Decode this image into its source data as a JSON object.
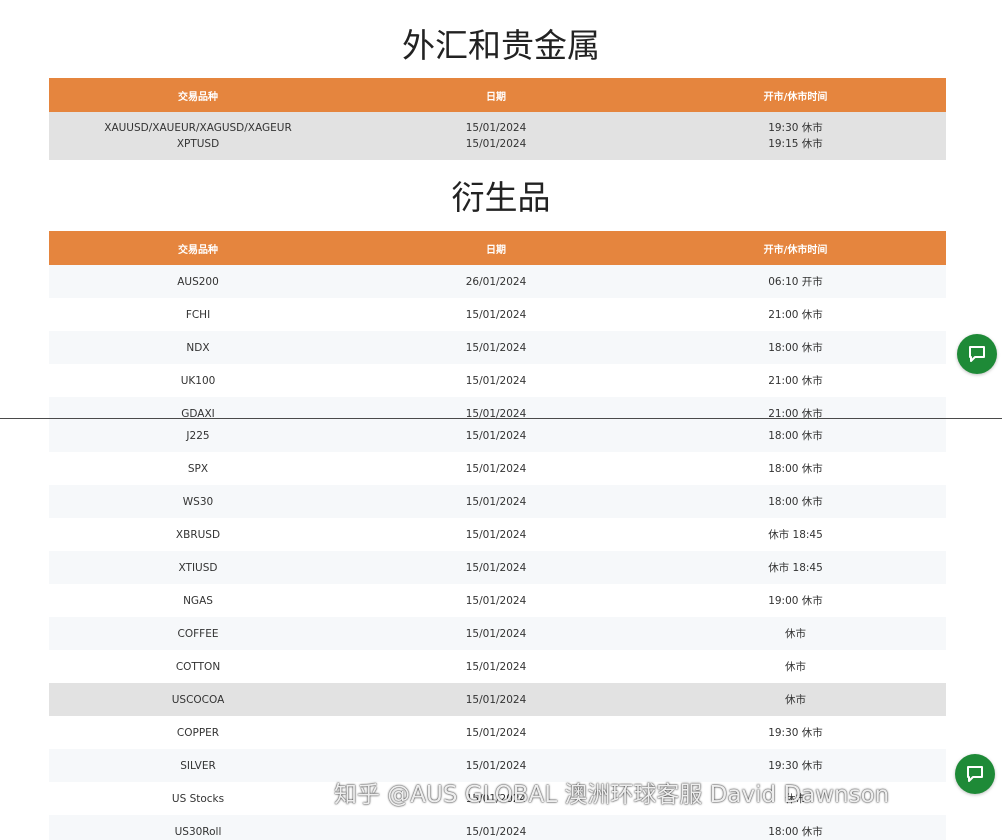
{
  "forex_section": {
    "title": "外汇和贵金属",
    "headers": [
      "交易品种",
      "日期",
      "开市/休市时间"
    ],
    "rows": [
      {
        "symbol": [
          "XAUUSD/XAUEUR/XAGUSD/XAGEUR",
          "XPTUSD"
        ],
        "date": [
          "15/01/2024",
          "15/01/2024"
        ],
        "time": [
          "19:30 休市",
          "19:15 休市"
        ]
      }
    ]
  },
  "derivatives_section": {
    "title": "衍生品",
    "headers": [
      "交易品种",
      "日期",
      "开市/休市时间"
    ],
    "rows_top": [
      {
        "symbol": "AUS200",
        "date": "26/01/2024",
        "time": "06:10 开市"
      },
      {
        "symbol": "FCHI",
        "date": "15/01/2024",
        "time": "21:00 休市"
      },
      {
        "symbol": "NDX",
        "date": "15/01/2024",
        "time": "18:00 休市"
      },
      {
        "symbol": "UK100",
        "date": "15/01/2024",
        "time": "21:00 休市"
      },
      {
        "symbol": "GDAXI",
        "date": "15/01/2024",
        "time": "21:00 休市"
      }
    ],
    "rows_bottom": [
      {
        "symbol": "J225",
        "date": "15/01/2024",
        "time": "18:00 休市"
      },
      {
        "symbol": "SPX",
        "date": "15/01/2024",
        "time": "18:00 休市"
      },
      {
        "symbol": "WS30",
        "date": "15/01/2024",
        "time": "18:00 休市"
      },
      {
        "symbol": "XBRUSD",
        "date": "15/01/2024",
        "time": "休市 18:45"
      },
      {
        "symbol": "XTIUSD",
        "date": "15/01/2024",
        "time": "休市 18:45"
      },
      {
        "symbol": "NGAS",
        "date": "15/01/2024",
        "time": "19:00 休市"
      },
      {
        "symbol": "COFFEE",
        "date": "15/01/2024",
        "time": "休市"
      },
      {
        "symbol": "COTTON",
        "date": "15/01/2024",
        "time": "休市"
      },
      {
        "symbol": "USCOCOA",
        "date": "15/01/2024",
        "time": "休市"
      },
      {
        "symbol": "COPPER",
        "date": "15/01/2024",
        "time": "19:30 休市"
      },
      {
        "symbol": "SILVER",
        "date": "15/01/2024",
        "time": "19:30 休市"
      },
      {
        "symbol": "US Stocks",
        "date": "15/01/2024",
        "time": "休市"
      },
      {
        "symbol": "US30Roll",
        "date": "15/01/2024",
        "time": "18:00 休市"
      }
    ]
  },
  "watermark": {
    "text": "知乎 @AUS GLOBAL 澳洲环球客服 David Dawnson"
  },
  "colors": {
    "header_orange": "#e5853e",
    "chat_green": "#1e8a37",
    "row_gray": "#e2e2e2",
    "row_light": "#f6f8fa"
  },
  "icons": [
    "chat-icon"
  ]
}
